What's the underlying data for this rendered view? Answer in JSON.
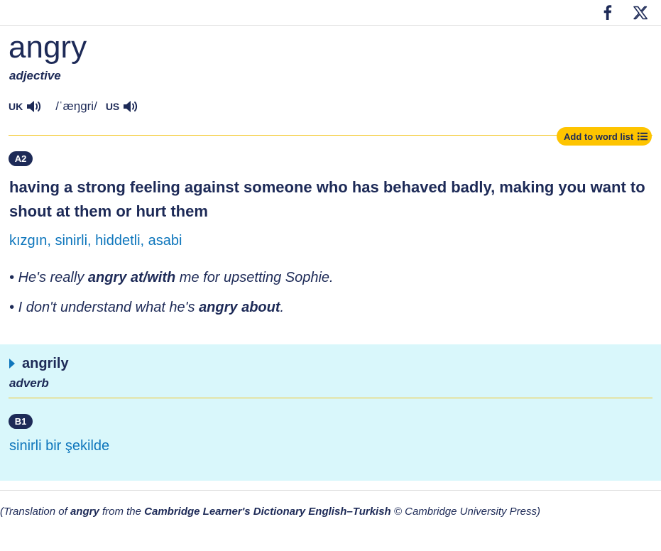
{
  "share": {
    "facebook_icon": "facebook-icon",
    "x_icon": "x-icon"
  },
  "entry": {
    "headword": "angry",
    "pos": "adjective",
    "pron": {
      "uk_label": "UK",
      "ipa": "/ˈæŋɡri/",
      "us_label": "US"
    },
    "add_to_word_list": "Add to word list",
    "sense": {
      "level": "A2",
      "definition": "having a strong feeling against someone who has behaved badly, making you want to shout at them or hurt them",
      "translation": "kızgın, sinirli, hiddetli, asabi",
      "examples": [
        {
          "bullet": "•",
          "pre": "He's really ",
          "bold": "angry at/with",
          "post": " me for upsetting Sophie."
        },
        {
          "bullet": "•",
          "pre": "I don't understand what he's ",
          "bold": "angry about",
          "post": "."
        }
      ]
    }
  },
  "runon": {
    "word": "angrily",
    "pos": "adverb",
    "level": "B1",
    "translation": "sinirli bir şekilde"
  },
  "credit": {
    "open": "(Translation of ",
    "word": "angry",
    "mid": " from the ",
    "source": "Cambridge Learner's Dictionary English–Turkish",
    "close": " © Cambridge University Press)"
  },
  "colors": {
    "navy": "#1d2a57",
    "link_blue": "#0e76bc",
    "yellow": "#fec400",
    "runon_bg": "#d9f7fb"
  }
}
